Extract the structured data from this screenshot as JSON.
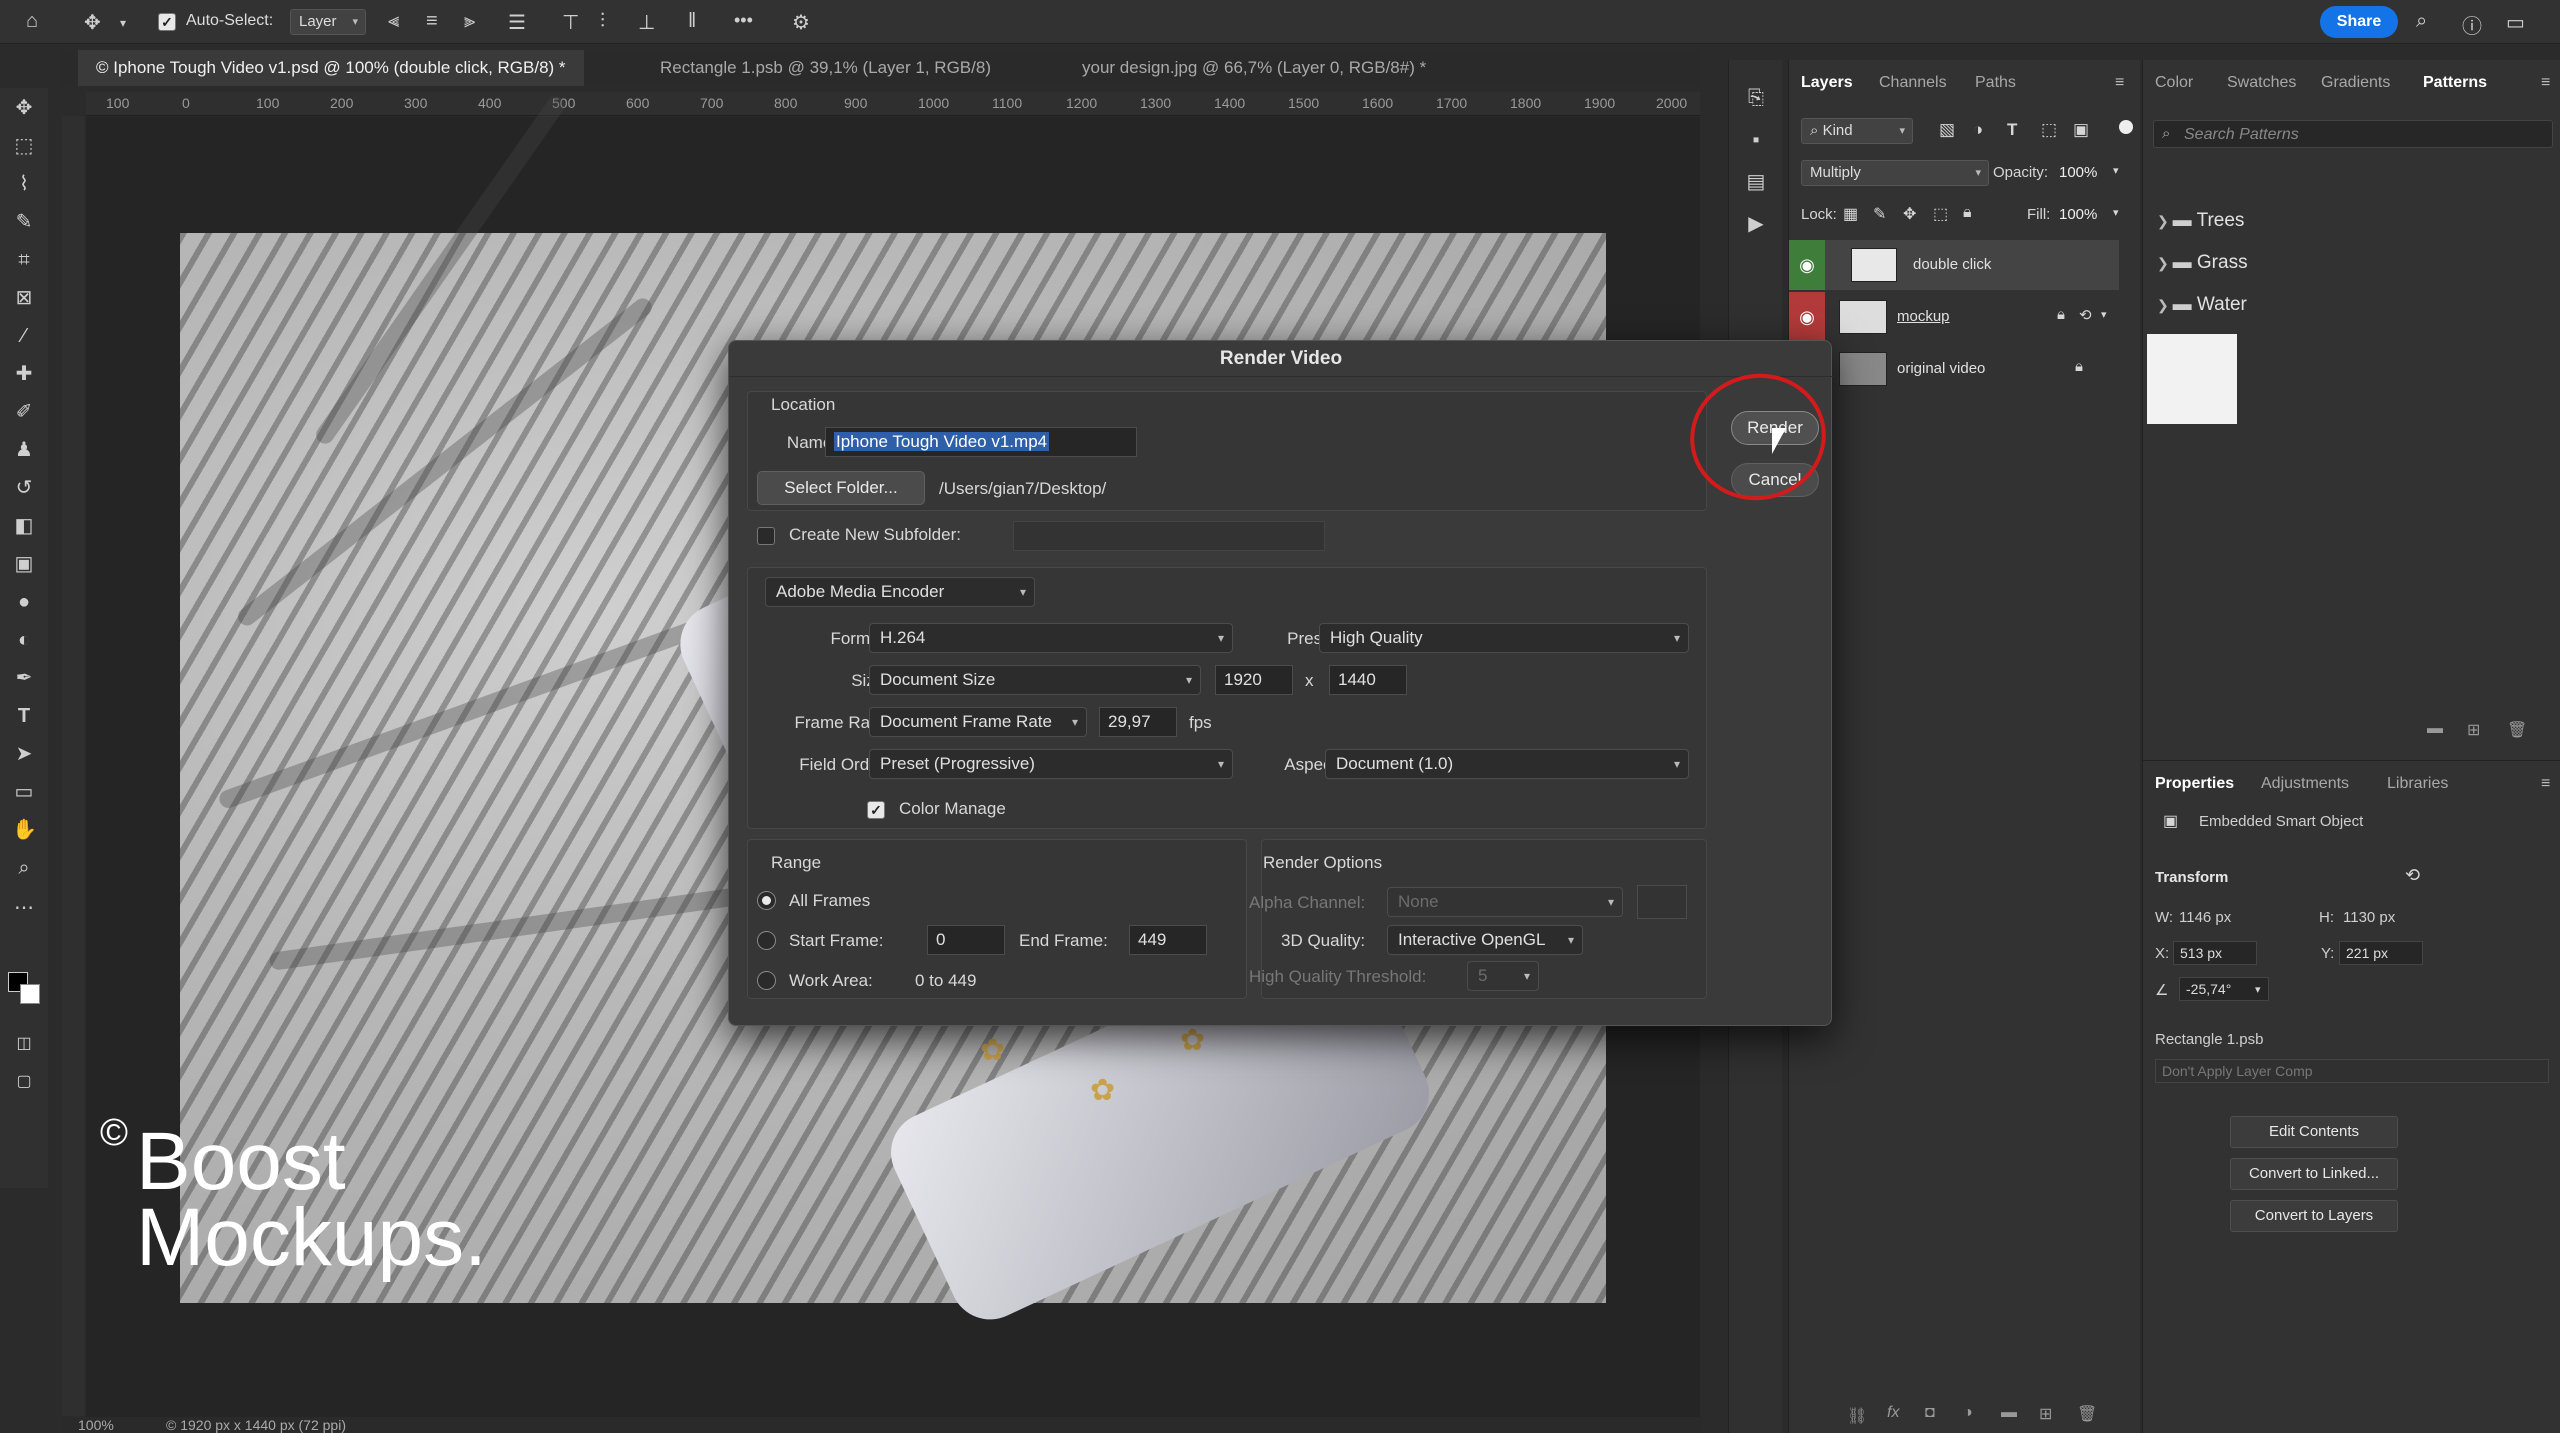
{
  "options_bar": {
    "auto_select_label": "Auto-Select:",
    "auto_select_value": "Layer",
    "more": "•••",
    "share_label": "Share"
  },
  "tabs": [
    {
      "label": "© Iphone Tough Video v1.psd @ 100% (double click, RGB/8) *"
    },
    {
      "label": "Rectangle 1.psb @ 39,1% (Layer 1, RGB/8)"
    },
    {
      "label": "your design.jpg @ 66,7% (Layer 0, RGB/8#) *"
    }
  ],
  "ruler": {
    "ticks": [
      "100",
      "0",
      "100",
      "200",
      "300",
      "400",
      "500",
      "600",
      "700",
      "800",
      "900",
      "1000",
      "1100",
      "1200",
      "1300",
      "1400",
      "1500",
      "1600",
      "1700",
      "1800",
      "1900",
      "2000"
    ]
  },
  "watermark": {
    "symbol": "©",
    "line1": "Boost",
    "line2": "Mockups."
  },
  "status": {
    "zoom": "100%",
    "doc_info": "© 1920 px x 1440 px (72 ppi)"
  },
  "layers_panel": {
    "tabs": [
      "Layers",
      "Channels",
      "Paths"
    ],
    "kind_label": "Kind",
    "blend_mode": "Multiply",
    "opacity_label": "Opacity:",
    "opacity_value": "100%",
    "lock_label": "Lock:",
    "fill_label": "Fill:",
    "fill_value": "100%",
    "layers": [
      {
        "name": "double click"
      },
      {
        "name": "mockup"
      },
      {
        "name": "original video"
      }
    ]
  },
  "patterns_panel": {
    "tabs": [
      "Color",
      "Swatches",
      "Gradients",
      "Patterns"
    ],
    "search_placeholder": "Search Patterns",
    "folders": [
      "Trees",
      "Grass",
      "Water"
    ]
  },
  "properties_panel": {
    "tabs": [
      "Properties",
      "Adjustments",
      "Libraries"
    ],
    "object_type": "Embedded Smart Object",
    "transform_label": "Transform",
    "w_label": "W:",
    "w_value": "1146 px",
    "h_label": "H:",
    "h_value": "1130 px",
    "x_label": "X:",
    "x_value": "513 px",
    "y_label": "Y:",
    "y_value": "221 px",
    "angle_value": "-25,74°",
    "linked_file": "Rectangle 1.psb",
    "layer_comp": "Don't Apply Layer Comp",
    "buttons": [
      "Edit Contents",
      "Convert to Linked...",
      "Convert to Layers"
    ]
  },
  "dialog": {
    "title": "Render Video",
    "location_label": "Location",
    "name_label": "Name:",
    "name_value": "Iphone Tough Video v1.mp4",
    "select_folder": "Select Folder...",
    "folder_path": "/Users/gian7/Desktop/",
    "subfolder_label": "Create New Subfolder:",
    "encoder": "Adobe Media Encoder",
    "format_label": "Format:",
    "format_value": "H.264",
    "preset_label": "Preset:",
    "preset_value": "High Quality",
    "size_label": "Size:",
    "size_value": "Document Size",
    "width_value": "1920",
    "x_sep": "x",
    "height_value": "1440",
    "framerate_label": "Frame Rate:",
    "framerate_value": "Document Frame Rate",
    "fps_value": "29,97",
    "fps_unit": "fps",
    "field_order_label": "Field Order:",
    "field_order_value": "Preset (Progressive)",
    "aspect_label": "Aspect:",
    "aspect_value": "Document (1.0)",
    "color_manage_label": "Color Manage",
    "range_label": "Range",
    "all_frames_label": "All Frames",
    "start_frame_label": "Start Frame:",
    "start_frame_value": "0",
    "end_frame_label": "End Frame:",
    "end_frame_value": "449",
    "work_area_label": "Work Area:",
    "work_area_value": "0 to 449",
    "render_options_label": "Render Options",
    "alpha_label": "Alpha Channel:",
    "alpha_value": "None",
    "quality3d_label": "3D Quality:",
    "quality3d_value": "Interactive OpenGL",
    "hq_threshold_label": "High Quality Threshold:",
    "hq_threshold_value": "5",
    "render_button": "Render",
    "cancel_button": "Cancel"
  },
  "colors": {
    "accent": "#1473e6",
    "annotation": "#d41b1b",
    "eye_active": "#3f7d3a",
    "eye_red": "#b33a3a"
  }
}
